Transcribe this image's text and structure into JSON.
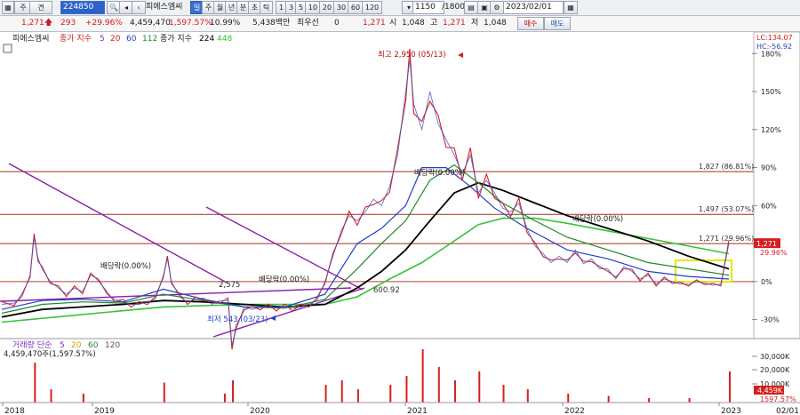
{
  "toolbar": {
    "mode_main": "주",
    "mode_sub": "견",
    "code": "224850",
    "stock_name": "피에스엠씨",
    "period_buttons": [
      "일",
      "주",
      "월",
      "년",
      "분",
      "초",
      "틱"
    ],
    "interval_buttons": [
      "1",
      "3",
      "5",
      "10",
      "20",
      "30",
      "60",
      "120"
    ],
    "count": "1150",
    "total": "/1800",
    "date": "2023/02/01",
    "buy": "매수",
    "sell": "매도"
  },
  "quote": {
    "price": "1,271",
    "change": "293",
    "change_pct": "+29.96%",
    "volume": "4,459,470",
    "volume_pct": "1,597.57%",
    "turnover": "10.99%",
    "amount": "5,438백만",
    "label_pref": "최우선",
    "pref_val": "0",
    "pref_price": "1,271",
    "open_label": "시",
    "open": "1,048",
    "high_label": "고",
    "high": "1,271",
    "low_label": "저",
    "low": "1,048"
  },
  "legend": {
    "name": "피에스엠씨",
    "ma_label": "종가 지수",
    "ma_periods": [
      "5",
      "20",
      "60",
      "112"
    ],
    "ma2_label": "종가 지수",
    "ma2_periods": [
      "224",
      "448"
    ],
    "lc": "LC:134.07",
    "hc": "HC:-56.92"
  },
  "colors": {
    "price": "#d42020",
    "ma5": "#7a2fbf",
    "ma20": "#d42020",
    "ma60": "#1f3fc8",
    "ma112": "#1e8a2a",
    "ma224": "#000000",
    "ma448": "#36c436",
    "trend": "#8a1ea8",
    "hline": "#a0301e",
    "box": "#ffff66"
  },
  "chart_data": {
    "type": "line",
    "x_labels": [
      "2018",
      "2019",
      "2020",
      "2021",
      "2022",
      "2023"
    ],
    "y_pct_ticks": [
      "180%",
      "150%",
      "120%",
      "90%",
      "60%",
      "30%",
      "0%",
      "-30%"
    ],
    "y_pct_values": [
      180,
      150,
      120,
      90,
      60,
      30,
      0,
      -30
    ],
    "price_axis": {
      "last_price_label": "1,271",
      "last_pct_label": "29.96%"
    },
    "annotations": [
      {
        "text": "최고 2,950 (05/13)"
      },
      {
        "text": "최저 543 (03/23)"
      },
      {
        "text": "배당락(0.00%)"
      },
      {
        "text": "배당락(0.00%)"
      },
      {
        "text": "배당락(0.00%)"
      },
      {
        "text": "배당락(0.00%)"
      },
      {
        "text": "2,575"
      },
      {
        "text": "600.92"
      }
    ],
    "horizontal_lines": [
      {
        "label": "1,827 (86.81%)",
        "price": 1827,
        "pct": 86.81
      },
      {
        "label": "1,497 (53.07%)",
        "price": 1497,
        "pct": 53.07
      },
      {
        "label": "1,271 (29.96%)",
        "price": 1271,
        "pct": 29.96
      }
    ],
    "series_price": [
      [
        0,
        -18
      ],
      [
        3,
        -17
      ],
      [
        5,
        -12
      ],
      [
        7,
        5
      ],
      [
        8,
        35
      ],
      [
        9,
        18
      ],
      [
        10,
        10
      ],
      [
        12,
        0
      ],
      [
        14,
        -5
      ],
      [
        16,
        -10
      ],
      [
        18,
        -5
      ],
      [
        20,
        -8
      ],
      [
        22,
        5
      ],
      [
        24,
        2
      ],
      [
        26,
        -10
      ],
      [
        28,
        -14
      ],
      [
        30,
        -16
      ],
      [
        32,
        -18
      ],
      [
        34,
        -18
      ],
      [
        36,
        -16
      ],
      [
        38,
        -14
      ],
      [
        40,
        5
      ],
      [
        41,
        18
      ],
      [
        42,
        0
      ],
      [
        44,
        -12
      ],
      [
        46,
        -16
      ],
      [
        48,
        -14
      ],
      [
        50,
        -13
      ],
      [
        52,
        -18
      ],
      [
        54,
        -15
      ],
      [
        56,
        -15
      ],
      [
        57,
        -50
      ],
      [
        58,
        -38
      ],
      [
        60,
        -20
      ],
      [
        62,
        -22
      ],
      [
        64,
        -20
      ],
      [
        66,
        -20
      ],
      [
        68,
        -21
      ],
      [
        70,
        -20
      ],
      [
        72,
        -21
      ],
      [
        74,
        -20
      ],
      [
        76,
        -18
      ],
      [
        78,
        -15
      ],
      [
        80,
        0
      ],
      [
        82,
        20
      ],
      [
        84,
        40
      ],
      [
        86,
        52
      ],
      [
        88,
        48
      ],
      [
        90,
        55
      ],
      [
        92,
        65
      ],
      [
        94,
        60
      ],
      [
        96,
        75
      ],
      [
        98,
        100
      ],
      [
        100,
        150
      ],
      [
        101,
        175
      ],
      [
        102,
        140
      ],
      [
        104,
        120
      ],
      [
        106,
        150
      ],
      [
        108,
        125
      ],
      [
        110,
        112
      ],
      [
        112,
        100
      ],
      [
        114,
        85
      ],
      [
        116,
        100
      ],
      [
        118,
        70
      ],
      [
        120,
        80
      ],
      [
        122,
        70
      ],
      [
        124,
        58
      ],
      [
        126,
        55
      ],
      [
        128,
        62
      ],
      [
        130,
        42
      ],
      [
        132,
        28
      ],
      [
        134,
        22
      ],
      [
        136,
        15
      ],
      [
        138,
        20
      ],
      [
        140,
        15
      ],
      [
        142,
        25
      ],
      [
        144,
        14
      ],
      [
        146,
        18
      ],
      [
        148,
        10
      ],
      [
        150,
        10
      ],
      [
        152,
        2
      ],
      [
        154,
        12
      ],
      [
        156,
        8
      ],
      [
        158,
        2
      ],
      [
        160,
        5
      ],
      [
        162,
        -2
      ],
      [
        164,
        2
      ],
      [
        166,
        0
      ],
      [
        168,
        -2
      ],
      [
        170,
        -2
      ],
      [
        172,
        0
      ],
      [
        174,
        -1
      ],
      [
        176,
        -3
      ],
      [
        178,
        -2
      ],
      [
        180,
        30
      ]
    ],
    "series_ma60": [
      [
        0,
        -22
      ],
      [
        10,
        -15
      ],
      [
        20,
        -14
      ],
      [
        30,
        -16
      ],
      [
        40,
        -6
      ],
      [
        50,
        -14
      ],
      [
        60,
        -20
      ],
      [
        70,
        -20
      ],
      [
        80,
        -10
      ],
      [
        88,
        30
      ],
      [
        94,
        42
      ],
      [
        100,
        60
      ],
      [
        104,
        90
      ],
      [
        110,
        90
      ],
      [
        116,
        75
      ],
      [
        122,
        58
      ],
      [
        130,
        42
      ],
      [
        140,
        25
      ],
      [
        150,
        18
      ],
      [
        160,
        8
      ],
      [
        170,
        4
      ],
      [
        180,
        2
      ]
    ],
    "series_ma112": [
      [
        0,
        -25
      ],
      [
        10,
        -18
      ],
      [
        20,
        -16
      ],
      [
        30,
        -17
      ],
      [
        40,
        -10
      ],
      [
        50,
        -15
      ],
      [
        60,
        -20
      ],
      [
        70,
        -21
      ],
      [
        80,
        -14
      ],
      [
        88,
        10
      ],
      [
        94,
        30
      ],
      [
        100,
        48
      ],
      [
        106,
        80
      ],
      [
        112,
        92
      ],
      [
        118,
        78
      ],
      [
        124,
        62
      ],
      [
        132,
        48
      ],
      [
        140,
        35
      ],
      [
        150,
        25
      ],
      [
        160,
        15
      ],
      [
        170,
        10
      ],
      [
        180,
        5
      ]
    ],
    "series_ma224": [
      [
        0,
        -28
      ],
      [
        10,
        -22
      ],
      [
        20,
        -20
      ],
      [
        30,
        -18
      ],
      [
        40,
        -15
      ],
      [
        50,
        -16
      ],
      [
        60,
        -18
      ],
      [
        70,
        -20
      ],
      [
        80,
        -18
      ],
      [
        88,
        -5
      ],
      [
        94,
        8
      ],
      [
        100,
        25
      ],
      [
        106,
        48
      ],
      [
        112,
        70
      ],
      [
        118,
        78
      ],
      [
        124,
        72
      ],
      [
        132,
        62
      ],
      [
        140,
        52
      ],
      [
        150,
        42
      ],
      [
        160,
        32
      ],
      [
        170,
        20
      ],
      [
        180,
        10
      ]
    ],
    "series_ma448": [
      [
        0,
        -32
      ],
      [
        20,
        -26
      ],
      [
        40,
        -20
      ],
      [
        60,
        -18
      ],
      [
        80,
        -18
      ],
      [
        88,
        -12
      ],
      [
        96,
        2
      ],
      [
        104,
        15
      ],
      [
        112,
        32
      ],
      [
        118,
        45
      ],
      [
        124,
        50
      ],
      [
        132,
        50
      ],
      [
        140,
        46
      ],
      [
        150,
        40
      ],
      [
        160,
        34
      ],
      [
        170,
        28
      ],
      [
        180,
        22
      ]
    ],
    "volume": [
      [
        8,
        18
      ],
      [
        12,
        6
      ],
      [
        20,
        4
      ],
      [
        40,
        9
      ],
      [
        55,
        4
      ],
      [
        57,
        10
      ],
      [
        80,
        8
      ],
      [
        84,
        10
      ],
      [
        88,
        6
      ],
      [
        96,
        8
      ],
      [
        100,
        12
      ],
      [
        104,
        24
      ],
      [
        108,
        16
      ],
      [
        112,
        10
      ],
      [
        118,
        14
      ],
      [
        124,
        8
      ],
      [
        130,
        6
      ],
      [
        140,
        4
      ],
      [
        150,
        3
      ],
      [
        160,
        2
      ],
      [
        170,
        2
      ],
      [
        180,
        14
      ]
    ],
    "volume_panel": {
      "title": "거래량 단순",
      "periods": [
        "5",
        "20",
        "60",
        "120"
      ],
      "value": "4,459,470주(1,597.57%)",
      "ticks": [
        "30,000K",
        "20,000K",
        "10,000K"
      ],
      "last_label": "4,459K",
      "last_pct": "1597.57%"
    },
    "date_axis": [
      "2018",
      "2019",
      "2020",
      "2021",
      "2022",
      "2023",
      "02/01"
    ]
  }
}
